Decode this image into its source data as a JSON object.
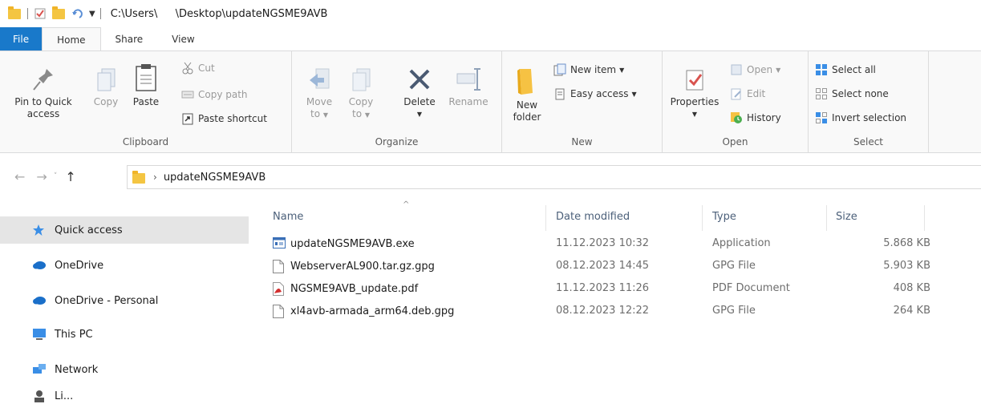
{
  "window": {
    "path_prefix": "C:\\Users\\",
    "path_suffix": "\\Desktop\\updateNGSME9AVB"
  },
  "tabs": [
    "File",
    "Home",
    "Share",
    "View"
  ],
  "ribbon": {
    "clipboard": {
      "label": "Clipboard",
      "pin_line1": "Pin to Quick",
      "pin_line2": "access",
      "copy": "Copy",
      "paste": "Paste",
      "cut": "Cut",
      "copy_path": "Copy path",
      "paste_shortcut": "Paste shortcut"
    },
    "organize": {
      "label": "Organize",
      "move_line1": "Move",
      "move_line2": "to",
      "copy_line1": "Copy",
      "copy_line2": "to",
      "delete": "Delete",
      "rename": "Rename"
    },
    "new": {
      "label": "New",
      "new_folder_line1": "New",
      "new_folder_line2": "folder",
      "new_item": "New item",
      "easy_access": "Easy access"
    },
    "open": {
      "label": "Open",
      "properties": "Properties",
      "open": "Open",
      "edit": "Edit",
      "history": "History"
    },
    "select": {
      "label": "Select",
      "select_all": "Select all",
      "select_none": "Select none",
      "invert_selection": "Invert selection"
    }
  },
  "address": {
    "crumb": "updateNGSME9AVB"
  },
  "nav": {
    "quick_access": "Quick access",
    "onedrive": "OneDrive",
    "onedrive_personal": "OneDrive - Personal",
    "this_pc": "This PC",
    "network": "Network",
    "partial": "Li..."
  },
  "columns": {
    "name": "Name",
    "date": "Date modified",
    "type": "Type",
    "size": "Size"
  },
  "files": [
    {
      "name": "updateNGSME9AVB.exe",
      "date": "11.12.2023 10:32",
      "type": "Application",
      "size": "5.868 KB",
      "icon": "exe"
    },
    {
      "name": "WebserverAL900.tar.gz.gpg",
      "date": "08.12.2023 14:45",
      "type": "GPG File",
      "size": "5.903 KB",
      "icon": "blank"
    },
    {
      "name": "NGSME9AVB_update.pdf",
      "date": "11.12.2023 11:26",
      "type": "PDF Document",
      "size": "408 KB",
      "icon": "pdf"
    },
    {
      "name": "xl4avb-armada_arm64.deb.gpg",
      "date": "08.12.2023 12:22",
      "type": "GPG File",
      "size": "264 KB",
      "icon": "blank"
    }
  ]
}
